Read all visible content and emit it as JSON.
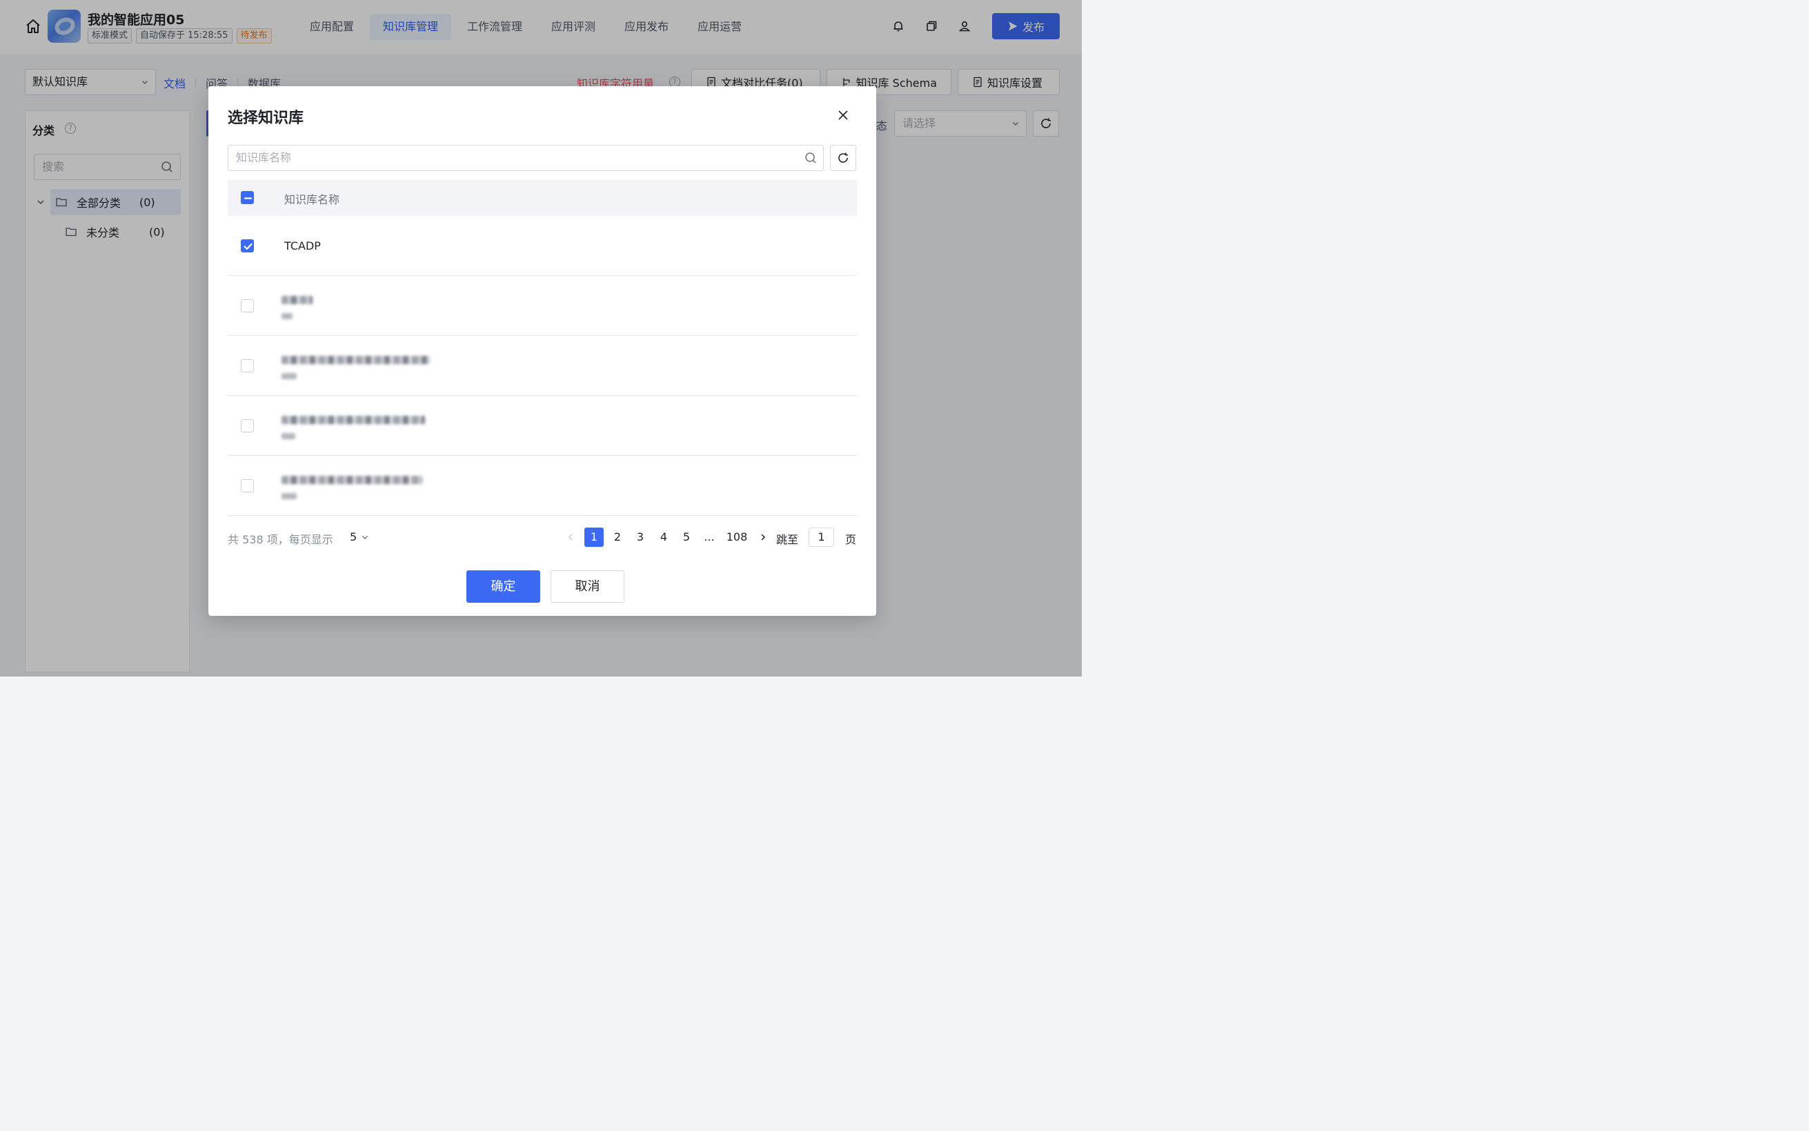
{
  "header": {
    "app_title": "我的智能应用05",
    "badges": {
      "mode": "标准模式",
      "autosave": "自动保存于 15:28:55",
      "status": "待发布"
    },
    "nav": [
      "应用配置",
      "知识库管理",
      "工作流管理",
      "应用评测",
      "应用发布",
      "应用运营"
    ],
    "nav_active": "知识库管理",
    "icons": [
      "home-icon",
      "bell-icon",
      "copy-icon",
      "user-icon"
    ],
    "publish_label": "发布"
  },
  "toolbar": {
    "kb_select": "默认知识库",
    "subtabs": [
      "文档",
      "问答",
      "数据库"
    ],
    "usage_link": "知识库字符用量",
    "compare_task": "文档对比任务(0)",
    "schema": "知识库 Schema",
    "settings": "知识库设置"
  },
  "sidebar": {
    "title": "分类",
    "search_placeholder": "搜索",
    "tree": [
      {
        "label": "全部分类",
        "count": "(0)"
      },
      {
        "label": "未分类",
        "count": "(0)"
      }
    ]
  },
  "filter": {
    "status_label": "态",
    "placeholder": "请选择"
  },
  "modal": {
    "title": "选择知识库",
    "search_placeholder": "知识库名称",
    "column_header": "知识库名称",
    "rows": [
      {
        "name": "TCADP",
        "checked": true
      },
      {
        "name": "",
        "checked": false
      },
      {
        "name": "",
        "checked": false
      },
      {
        "name": "",
        "checked": false
      },
      {
        "name": "",
        "checked": false
      }
    ],
    "pagination": {
      "total": "共 538 项，每页显示",
      "page_size": "5",
      "pages": [
        "1",
        "2",
        "3",
        "4",
        "5",
        "...",
        "108"
      ],
      "current": "1",
      "jump_label": "跳至",
      "jump_value": "1",
      "page_suffix": "页"
    },
    "confirm": "确定",
    "cancel": "取消"
  },
  "colors": {
    "accent": "#3c6af5",
    "warn": "#e27524",
    "danger": "#e34d59"
  }
}
